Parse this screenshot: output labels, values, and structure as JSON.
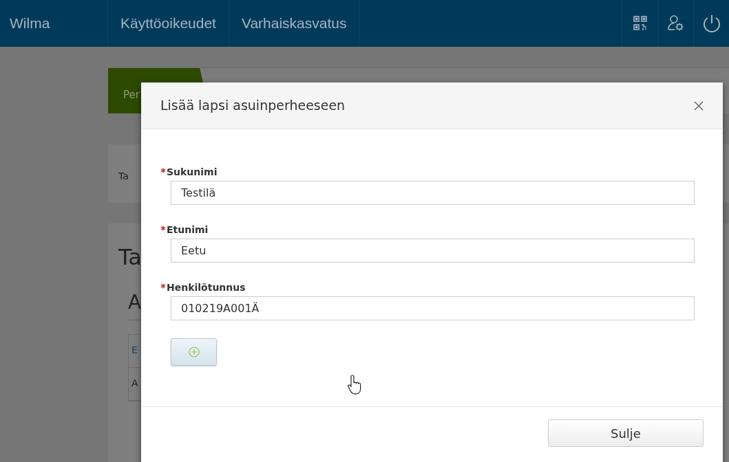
{
  "navbar": {
    "brand": "Wilma",
    "links": [
      {
        "label": "Käyttöoikeudet"
      },
      {
        "label": "Varhaiskasvatus"
      }
    ]
  },
  "background": {
    "tab": {
      "label": "Per",
      "selected": true
    },
    "card_text": "Ta",
    "heading": "Ta",
    "subheading": "A",
    "table": [
      {
        "cell": "E",
        "kind": "link"
      },
      {
        "cell": "A",
        "kind": "text"
      }
    ]
  },
  "modal": {
    "title": "Lisää lapsi asuinperheeseen",
    "fields": [
      {
        "label": "Sukunimi",
        "required": true,
        "value": "Testilä"
      },
      {
        "label": "Etunimi",
        "required": true,
        "value": "Eetu"
      },
      {
        "label": "Henkilötunnus",
        "required": true,
        "value": "010219A001Ä"
      }
    ],
    "close_button": "Sulje"
  }
}
